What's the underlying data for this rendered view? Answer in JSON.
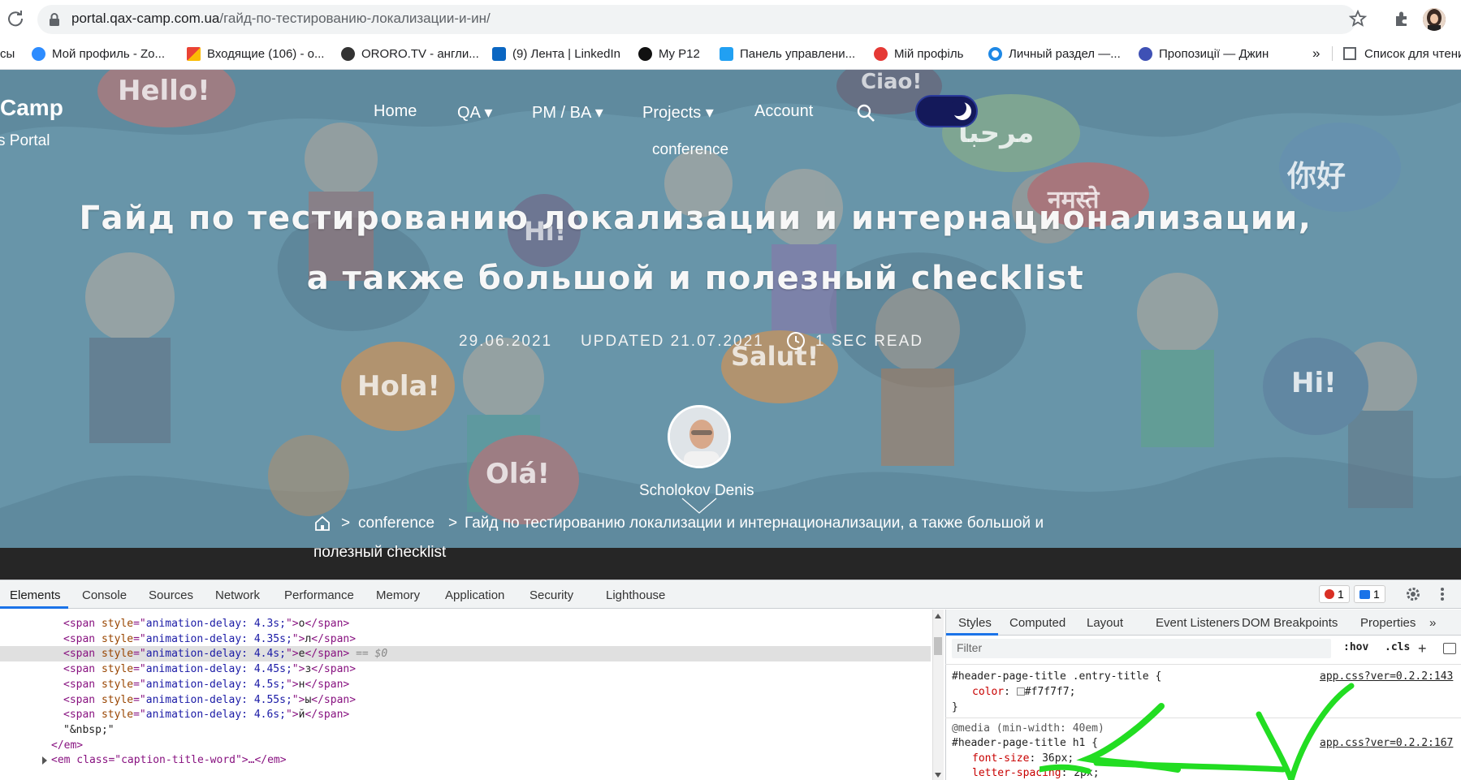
{
  "browser": {
    "url_host": "portal.qax-camp.com.ua",
    "url_path": "/гайд-по-тестированию-локализации-и-ин/",
    "bookmarks": [
      {
        "label": "сы",
        "color": "#5f6368"
      },
      {
        "label": "Мой профиль - Zo...",
        "color": "#2d8cff"
      },
      {
        "label": "Входящие (106) - o...",
        "color": "#ea4335"
      },
      {
        "label": "ORORO.TV - англи...",
        "color": "#333333"
      },
      {
        "label": "(9) Лента | LinkedIn",
        "color": "#0a66c2"
      },
      {
        "label": "My P12",
        "color": "#111111"
      },
      {
        "label": "Панель управлени...",
        "color": "#21a0f2"
      },
      {
        "label": "Мій профіль",
        "color": "#e53935"
      },
      {
        "label": "Личный раздел —...",
        "color": "#1e88e5"
      },
      {
        "label": "Пропозиції — Джин",
        "color": "#3f51b5"
      }
    ],
    "more_bookmarks": "»",
    "reading_list": "Список для чтени"
  },
  "site": {
    "logo_title": "Camp",
    "logo_subtitle": "s Portal",
    "nav": [
      {
        "label": "Home"
      },
      {
        "label": "QA ▾"
      },
      {
        "label": "PM / BA ▾"
      },
      {
        "label": "Projects ▾"
      },
      {
        "label": "Account"
      }
    ],
    "category": "conference",
    "title_line1": "Гайд по тестированию локализации и интернационализации,",
    "title_line2": "а также большой и полезный checklist",
    "date": "29.06.2021",
    "updated": "UPDATED 21.07.2021",
    "read_time": "1 SEC READ",
    "author": "Scholokov Denis",
    "breadcrumb_sep": ">",
    "breadcrumb_category": "conference",
    "breadcrumb_current_line1": "Гайд по тестированию локализации и интернационализации, а также большой и",
    "breadcrumb_current_line2": "полезный checklist",
    "bubbles": [
      "Hello!",
      "Hi!",
      "Hola!",
      "Salut!",
      "Olá!",
      "Hi!",
      "你好",
      "مرحبا",
      "नमस्ते",
      "Ciao!"
    ]
  },
  "devtools": {
    "tabs": [
      "Elements",
      "Console",
      "Sources",
      "Network",
      "Performance",
      "Memory",
      "Application",
      "Security",
      "Lighthouse"
    ],
    "error_count": "1",
    "message_count": "1",
    "dom_lines": [
      {
        "delay": "4.3s;",
        "char": "о"
      },
      {
        "delay": "4.35s;",
        "char": "л"
      },
      {
        "delay": "4.4s;",
        "char": "е"
      },
      {
        "delay": "4.45s;",
        "char": "з"
      },
      {
        "delay": "4.5s;",
        "char": "н"
      },
      {
        "delay": "4.55s;",
        "char": "ы"
      },
      {
        "delay": "4.6s;",
        "char": "й"
      }
    ],
    "selected_marker": "== $0",
    "nbsp_line": "\"&nbsp;\"",
    "em_close": "</em>",
    "em_next": "<em class=\"caption-title-word\">…</em>",
    "styles_tabs": [
      "Styles",
      "Computed",
      "Layout",
      "Event Listeners",
      "DOM Breakpoints",
      "Properties"
    ],
    "filter_placeholder": "Filter",
    "hov": ":hov",
    "cls": ".cls",
    "rule1_selector": "#header-page-title .entry-title {",
    "rule1_prop": "color",
    "rule1_value": "#f7f7f7;",
    "rule_close": "}",
    "rule1_source": "app.css?ver=0.2.2:143",
    "media_query": "@media (min-width: 40em)",
    "rule2_selector": "#header-page-title h1 {",
    "rule2_prop1": "font-size",
    "rule2_val1": "36px;",
    "rule2_prop2": "letter-spacing",
    "rule2_val2": "2px;",
    "rule2_source": "app.css?ver=0.2.2:167"
  }
}
